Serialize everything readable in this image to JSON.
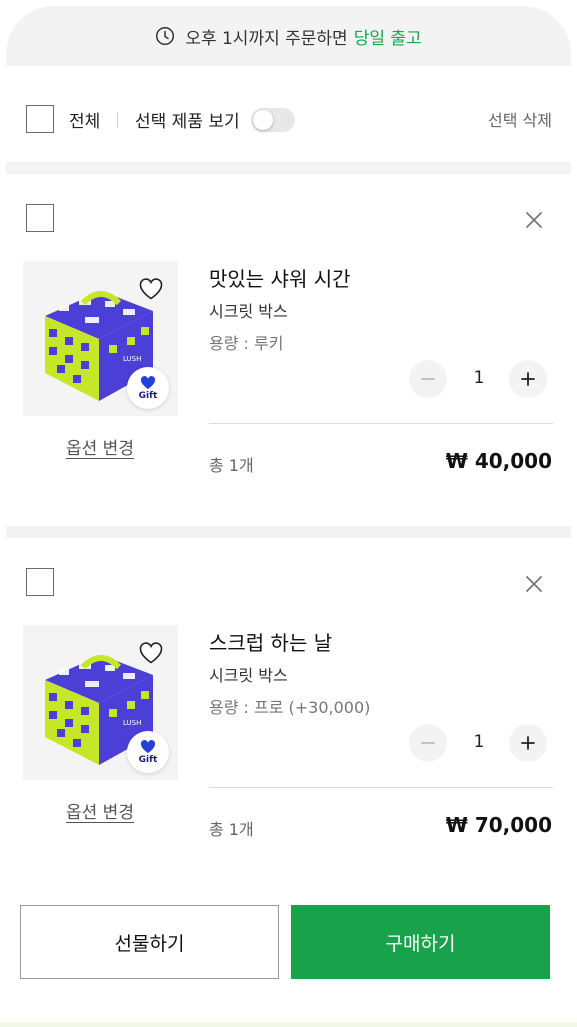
{
  "banner": {
    "icon": "clock-icon",
    "text": "오후 1시까지 주문하면",
    "highlight": "당일 출고",
    "highlight_color": "#1aa34a"
  },
  "select_bar": {
    "all_label": "전체",
    "view_selected_label": "선택 제품 보기",
    "toggle_on": false,
    "delete_selected_label": "선택 삭제"
  },
  "items": [
    {
      "name": "맛있는 샤워 시간",
      "type": "시크릿 박스",
      "option": "용량 : 루키",
      "quantity": "1",
      "total_label": "총 1개",
      "price": "₩ 40,000",
      "change_option_label": "옵션 변경",
      "badge": "Gift",
      "image_text": "LUSH"
    },
    {
      "name": "스크럽 하는 날",
      "type": "시크릿 박스",
      "option": "용량 : 프로 (+30,000)",
      "quantity": "1",
      "total_label": "총 1개",
      "price": "₩ 70,000",
      "change_option_label": "옵션 변경",
      "badge": "Gift",
      "image_text": "LUSH"
    }
  ],
  "actions": {
    "gift_label": "선물하기",
    "buy_label": "구매하기",
    "buy_color": "#18a24c"
  }
}
